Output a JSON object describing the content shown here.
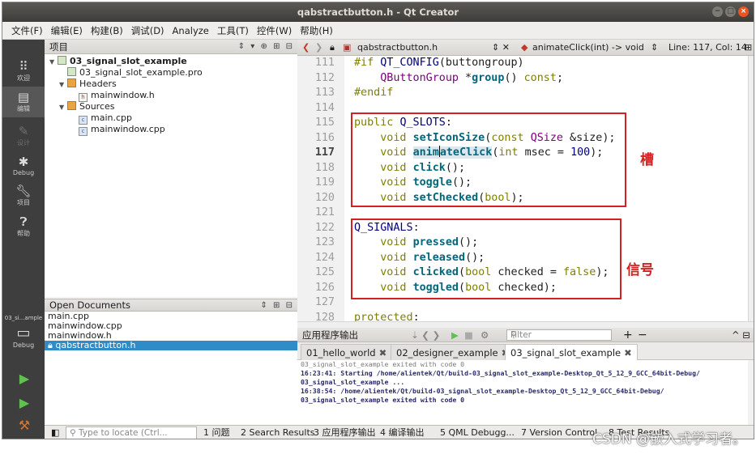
{
  "window": {
    "title": "qabstractbutton.h - Qt Creator",
    "controls": [
      "−",
      "□",
      "×"
    ]
  },
  "menubar": [
    "文件(F)",
    "编辑(E)",
    "构建(B)",
    "调试(D)",
    "Analyze",
    "工具(T)",
    "控件(W)",
    "帮助(H)"
  ],
  "modes": [
    {
      "label": "欢迎",
      "icon": "grid-icon"
    },
    {
      "label": "编辑",
      "icon": "edit-icon",
      "active": true
    },
    {
      "label": "设计",
      "icon": "pencil-icon",
      "disabled": true
    },
    {
      "label": "Debug",
      "icon": "bug-icon"
    },
    {
      "label": "项目",
      "icon": "wrench-icon"
    },
    {
      "label": "帮助",
      "icon": "help-icon"
    }
  ],
  "kit": {
    "label": "03_si...ample",
    "mode": "Debug"
  },
  "project_panel": {
    "title": "项目",
    "tools": "⇕ ▾ ⊕ ⊞ ⊟",
    "tree": [
      {
        "label": "03_signal_slot_example",
        "type": "project",
        "level": 0,
        "expanded": true
      },
      {
        "label": "03_signal_slot_example.pro",
        "type": "pro",
        "level": 1
      },
      {
        "label": "Headers",
        "type": "folder",
        "level": 1,
        "expanded": true
      },
      {
        "label": "mainwindow.h",
        "type": "header",
        "level": 2
      },
      {
        "label": "Sources",
        "type": "folder",
        "level": 1,
        "expanded": true
      },
      {
        "label": "main.cpp",
        "type": "cpp",
        "level": 2
      },
      {
        "label": "mainwindow.cpp",
        "type": "cpp",
        "level": 2
      }
    ]
  },
  "open_documents": {
    "title": "Open Documents",
    "items": [
      "main.cpp",
      "mainwindow.cpp",
      "mainwindow.h",
      "qabstractbutton.h"
    ],
    "selected_index": 3
  },
  "editor_toolbar": {
    "file": "qabstractbutton.h",
    "symbol": "animateClick(int) -> void",
    "position": "Line: 117, Col: 14"
  },
  "code_lines": [
    {
      "n": "111",
      "html": "<span class=\"kw\">#if</span> <span class=\"mac\">QT_CONFIG</span>(buttongroup)"
    },
    {
      "n": "112",
      "html": "    <span class=\"ty\">QButtonGroup</span> *<span class=\"fn\">group</span>() <span class=\"kw\">const</span>;"
    },
    {
      "n": "113",
      "html": "<span class=\"kw\">#endif</span>"
    },
    {
      "n": "114",
      "html": ""
    },
    {
      "n": "115",
      "html": "<span class=\"kw\">public</span> <span class=\"mac\">Q_SLOTS</span>:"
    },
    {
      "n": "116",
      "html": "    <span class=\"kw\">void</span> <span class=\"fn\">setIconSize</span>(<span class=\"kw\">const</span> <span class=\"ty\">QSize</span> &amp;size);"
    },
    {
      "n": "117",
      "html": "    <span class=\"kw\">void</span> <span class=\"fn hl\">anim<span class=\"cursor\"></span>ateClick</span>(<span class=\"kw\">int</span> msec = <span class=\"num\">100</span>);",
      "current": true
    },
    {
      "n": "118",
      "html": "    <span class=\"kw\">void</span> <span class=\"fn\">click</span>();"
    },
    {
      "n": "119",
      "html": "    <span class=\"kw\">void</span> <span class=\"fn\">toggle</span>();"
    },
    {
      "n": "120",
      "html": "    <span class=\"kw\">void</span> <span class=\"fn\">setChecked</span>(<span class=\"kw\">bool</span>);"
    },
    {
      "n": "121",
      "html": ""
    },
    {
      "n": "122",
      "html": "<span class=\"mac\">Q_SIGNALS</span>:"
    },
    {
      "n": "123",
      "html": "    <span class=\"kw\">void</span> <span class=\"fn\">pressed</span>();"
    },
    {
      "n": "124",
      "html": "    <span class=\"kw\">void</span> <span class=\"fn\">released</span>();"
    },
    {
      "n": "125",
      "html": "    <span class=\"kw\">void</span> <span class=\"fn\">clicked</span>(<span class=\"kw\">bool</span> checked = <span class=\"kw\">false</span>);"
    },
    {
      "n": "126",
      "html": "    <span class=\"kw\">void</span> <span class=\"fn\">toggled</span>(<span class=\"kw\">bool</span> checked);"
    },
    {
      "n": "127",
      "html": ""
    },
    {
      "n": "128",
      "html": "<span class=\"kw\">protected</span>:"
    }
  ],
  "annotations": {
    "slots": "槽",
    "signals": "信号"
  },
  "output_pane": {
    "title": "应用程序输出",
    "filter_placeholder": "Filter",
    "tabs": [
      "01_hello_world",
      "02_designer_example",
      "03_signal_slot_example"
    ],
    "active_tab": 2,
    "lines": [
      {
        "text": "03_signal_slot_example exited with code 0",
        "style": "gray"
      },
      {
        "text": "",
        "style": ""
      },
      {
        "text": "16:23:41: Starting /home/alientek/Qt/build-03_signal_slot_example-Desktop_Qt_5_12_9_GCC_64bit-Debug/",
        "style": "bold"
      },
      {
        "text": "03_signal_slot_example ...",
        "style": "bold"
      },
      {
        "text": "16:38:54: /home/alientek/Qt/build-03_signal_slot_example-Desktop_Qt_5_12_9_GCC_64bit-Debug/",
        "style": "bold"
      },
      {
        "text": "03_signal_slot_example exited with code 0",
        "style": "bold"
      }
    ]
  },
  "statusbar": {
    "locator_placeholder": "Type to locate (Ctrl...",
    "tabs": [
      "1 问题",
      "2 Search Results",
      "3 应用程序输出",
      "4 编译输出",
      "5 QML Debugg...",
      "7 Version Control",
      "8 Test Results"
    ]
  },
  "watermark": "CSDN @嵌入式学习者。"
}
